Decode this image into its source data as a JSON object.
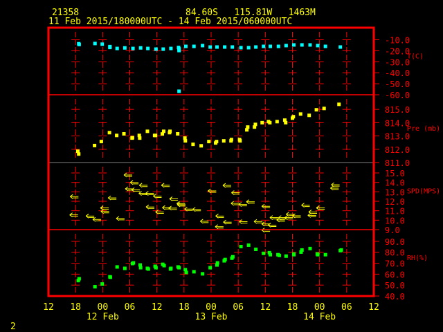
{
  "header": {
    "station": "21358",
    "location": "84.60S   115.81W   1463M",
    "time_range": "11 Feb 2015/180000UTC - 14 Feb 2015/060000UTC"
  },
  "footer": {
    "page": "2"
  },
  "colors": {
    "frame": "#ff0000",
    "text": "#ffff00",
    "temp": "#00ffff",
    "pressure": "#ffff00",
    "speed": "#ffff00",
    "rh": "#00ff00",
    "divider": "#808080"
  },
  "chart_data": {
    "type": "scatter",
    "title": "21358  84.60S 115.81W 1463M",
    "xaxis": {
      "unit": "hours since 11 Feb 12UTC",
      "range": [
        0,
        72
      ],
      "tick_hours": [
        0,
        6,
        12,
        18,
        24,
        30,
        36,
        42,
        48,
        54,
        60,
        66,
        72
      ],
      "tick_labels": [
        "12",
        "18",
        "00",
        "06",
        "12",
        "18",
        "00",
        "06",
        "12",
        "18",
        "00",
        "06",
        "12"
      ],
      "day_labels": [
        {
          "hour": 12,
          "label": "12 Feb"
        },
        {
          "hour": 36,
          "label": "13 Feb"
        },
        {
          "hour": 60,
          "label": "14 Feb"
        }
      ]
    },
    "panels": [
      {
        "id": "temp",
        "label": "T(C)",
        "ylim": [
          -60,
          1
        ],
        "ticks": [
          -10,
          -20,
          -30,
          -40,
          -50,
          -60
        ],
        "tick_labels": [
          "-10.0",
          "-20.0",
          "-30.0",
          "-40.0",
          "-50.0",
          "-60.0"
        ],
        "marker": "square",
        "points": [
          [
            6.7,
            -13.6
          ],
          [
            6.8,
            -14.3
          ],
          [
            10.3,
            -13.4
          ],
          [
            11.9,
            -14.0
          ],
          [
            13.6,
            -16.2
          ],
          [
            13.6,
            -17.0
          ],
          [
            15.2,
            -17.9
          ],
          [
            16.9,
            -17.4
          ],
          [
            18.7,
            -17.9
          ],
          [
            20.4,
            -17.4
          ],
          [
            22.0,
            -17.9
          ],
          [
            23.8,
            -18.5
          ],
          [
            25.4,
            -18.5
          ],
          [
            27.1,
            -17.9
          ],
          [
            28.8,
            -17.0
          ],
          [
            28.9,
            -18.3
          ],
          [
            28.9,
            -19.8
          ],
          [
            28.9,
            -56.8
          ],
          [
            30.4,
            -16.0
          ],
          [
            32.2,
            -16.0
          ],
          [
            34.1,
            -15.3
          ],
          [
            35.8,
            -16.6
          ],
          [
            37.3,
            -16.6
          ],
          [
            39.0,
            -16.6
          ],
          [
            40.7,
            -16.6
          ],
          [
            42.6,
            -17.2
          ],
          [
            44.3,
            -17.2
          ],
          [
            45.9,
            -16.6
          ],
          [
            47.6,
            -16.0
          ],
          [
            49.1,
            -16.0
          ],
          [
            50.9,
            -16.0
          ],
          [
            52.6,
            -15.3
          ],
          [
            54.3,
            -14.7
          ],
          [
            56.1,
            -14.7
          ],
          [
            57.9,
            -14.7
          ],
          [
            59.6,
            -15.3
          ],
          [
            61.3,
            -16.0
          ],
          [
            64.6,
            -16.6
          ]
        ]
      },
      {
        "id": "pressure",
        "label": "Pre (mb)",
        "ylim": [
          811,
          816.1
        ],
        "ticks": [
          811,
          812,
          813,
          814,
          815
        ],
        "tick_labels": [
          "811.0",
          "812.0",
          "813.0",
          "814.0",
          "815.0"
        ],
        "marker": "square",
        "points": [
          [
            6.5,
            811.85
          ],
          [
            6.7,
            811.64
          ],
          [
            10.2,
            812.28
          ],
          [
            11.7,
            812.58
          ],
          [
            13.5,
            813.25
          ],
          [
            15.1,
            813.04
          ],
          [
            16.7,
            813.16
          ],
          [
            18.5,
            812.84
          ],
          [
            18.6,
            812.87
          ],
          [
            20.1,
            813.04
          ],
          [
            20.2,
            812.84
          ],
          [
            21.9,
            813.35
          ],
          [
            23.5,
            813.04
          ],
          [
            23.7,
            813.04
          ],
          [
            25.2,
            813.15
          ],
          [
            25.5,
            813.35
          ],
          [
            26.8,
            813.25
          ],
          [
            26.9,
            813.35
          ],
          [
            28.6,
            813.16
          ],
          [
            30.2,
            812.84
          ],
          [
            30.3,
            812.63
          ],
          [
            32.0,
            812.37
          ],
          [
            33.8,
            812.26
          ],
          [
            35.5,
            812.58
          ],
          [
            37.0,
            812.47
          ],
          [
            37.2,
            812.58
          ],
          [
            38.8,
            812.63
          ],
          [
            40.4,
            812.63
          ],
          [
            40.5,
            812.73
          ],
          [
            42.3,
            812.73
          ],
          [
            42.4,
            812.63
          ],
          [
            43.9,
            813.46
          ],
          [
            44.1,
            813.67
          ],
          [
            45.6,
            813.67
          ],
          [
            45.8,
            813.87
          ],
          [
            47.3,
            814.0
          ],
          [
            48.7,
            814.08
          ],
          [
            49.0,
            814.0
          ],
          [
            50.6,
            814.08
          ],
          [
            52.3,
            814.19
          ],
          [
            52.5,
            814.0
          ],
          [
            54.0,
            814.34
          ],
          [
            54.2,
            814.45
          ],
          [
            55.8,
            814.65
          ],
          [
            57.7,
            814.55
          ],
          [
            59.3,
            814.97
          ],
          [
            61.0,
            815.07
          ],
          [
            64.3,
            815.38
          ]
        ]
      },
      {
        "id": "speed",
        "label": "SPD(MPS)",
        "ylim": [
          9,
          16.1
        ],
        "ticks": [
          9,
          10,
          11,
          12,
          13,
          14,
          15
        ],
        "tick_labels": [
          "9.0",
          "10.0",
          "11.0",
          "12.0",
          "13.0",
          "14.0",
          "15.0"
        ],
        "marker": "wind-arrow",
        "points": [
          [
            4.8,
            12.5
          ],
          [
            4.7,
            10.56
          ],
          [
            8.3,
            10.44
          ],
          [
            9.8,
            10.08
          ],
          [
            13.2,
            12.36
          ],
          [
            11.5,
            11.3
          ],
          [
            11.6,
            10.92
          ],
          [
            15.0,
            10.18
          ],
          [
            16.7,
            14.78
          ],
          [
            18.1,
            13.99
          ],
          [
            17.0,
            13.32
          ],
          [
            18.4,
            13.22
          ],
          [
            20.1,
            13.7
          ],
          [
            20.0,
            12.84
          ],
          [
            21.5,
            12.84
          ],
          [
            23.2,
            12.55
          ],
          [
            21.6,
            11.4
          ],
          [
            23.7,
            10.87
          ],
          [
            25.0,
            13.7
          ],
          [
            25.2,
            11.33
          ],
          [
            26.6,
            11.28
          ],
          [
            26.8,
            12.26
          ],
          [
            28.4,
            11.76
          ],
          [
            28.5,
            11.64
          ],
          [
            30.1,
            11.18
          ],
          [
            31.9,
            11.14
          ],
          [
            33.6,
            9.89
          ],
          [
            35.3,
            13.1
          ],
          [
            37.0,
            10.44
          ],
          [
            36.9,
            9.31
          ],
          [
            38.7,
            9.79
          ],
          [
            38.6,
            13.68
          ],
          [
            40.5,
            12.91
          ],
          [
            40.4,
            11.78
          ],
          [
            42.1,
            11.66
          ],
          [
            42.2,
            9.84
          ],
          [
            43.8,
            11.95
          ],
          [
            45.5,
            9.86
          ],
          [
            47.2,
            9.6
          ],
          [
            47.2,
            8.95
          ],
          [
            47.2,
            11.47
          ],
          [
            48.6,
            9.48
          ],
          [
            49.0,
            10.27
          ],
          [
            50.5,
            10.03
          ],
          [
            50.9,
            10.27
          ],
          [
            52.3,
            10.27
          ],
          [
            52.6,
            10.63
          ],
          [
            54.0,
            10.46
          ],
          [
            56.0,
            11.59
          ],
          [
            57.4,
            10.51
          ],
          [
            57.6,
            10.87
          ],
          [
            59.3,
            11.3
          ],
          [
            62.4,
            13.39
          ],
          [
            62.6,
            13.75
          ]
        ]
      },
      {
        "id": "rh",
        "label": "RH(%)",
        "ylim": [
          40,
          100.7
        ],
        "ticks": [
          40,
          50,
          60,
          70,
          80,
          90
        ],
        "tick_labels": [
          "40.0",
          "50.0",
          "60.0",
          "70.0",
          "80.0",
          "90.0"
        ],
        "marker": "square",
        "points": [
          [
            6.6,
            54.1
          ],
          [
            6.8,
            55.8
          ],
          [
            10.3,
            48.5
          ],
          [
            11.9,
            51.0
          ],
          [
            13.6,
            57.6
          ],
          [
            13.7,
            57.2
          ],
          [
            15.2,
            66.6
          ],
          [
            16.9,
            65.3
          ],
          [
            18.6,
            69.7
          ],
          [
            18.8,
            70.3
          ],
          [
            20.3,
            68.4
          ],
          [
            20.4,
            65.9
          ],
          [
            21.9,
            65.3
          ],
          [
            22.1,
            64.7
          ],
          [
            23.6,
            67.2
          ],
          [
            23.8,
            65.9
          ],
          [
            25.3,
            69.0
          ],
          [
            25.6,
            67.8
          ],
          [
            27.0,
            64.7
          ],
          [
            27.1,
            65.3
          ],
          [
            28.7,
            66.6
          ],
          [
            28.9,
            65.9
          ],
          [
            30.3,
            64.1
          ],
          [
            30.5,
            61.6
          ],
          [
            32.2,
            62.2
          ],
          [
            34.1,
            60.3
          ],
          [
            35.8,
            65.9
          ],
          [
            37.3,
            68.4
          ],
          [
            37.4,
            70.3
          ],
          [
            38.9,
            72.2
          ],
          [
            39.1,
            73.4
          ],
          [
            40.6,
            74.6
          ],
          [
            40.8,
            75.9
          ],
          [
            42.6,
            85.2
          ],
          [
            44.3,
            86.5
          ],
          [
            45.9,
            82.7
          ],
          [
            47.6,
            79.0
          ],
          [
            48.9,
            79.6
          ],
          [
            49.1,
            77.8
          ],
          [
            50.8,
            77.8
          ],
          [
            51.1,
            77.1
          ],
          [
            52.6,
            76.5
          ],
          [
            54.3,
            77.8
          ],
          [
            54.3,
            78.4
          ],
          [
            55.9,
            80.2
          ],
          [
            56.1,
            82.1
          ],
          [
            57.9,
            83.4
          ],
          [
            59.5,
            78.4
          ],
          [
            59.6,
            77.8
          ],
          [
            61.3,
            77.8
          ],
          [
            64.6,
            81.5
          ],
          [
            64.8,
            82.1
          ]
        ]
      }
    ]
  }
}
